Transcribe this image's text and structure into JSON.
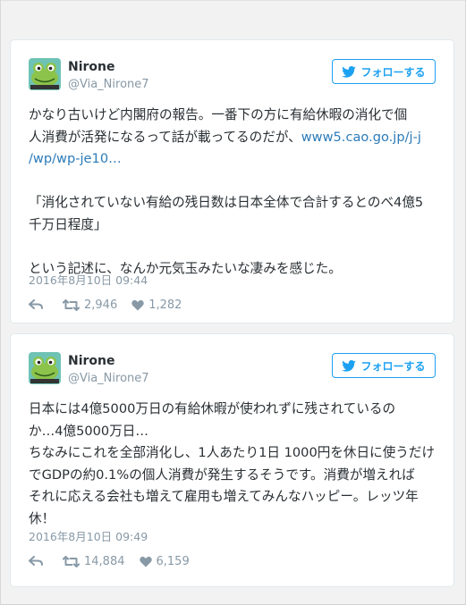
{
  "tweets": [
    {
      "author": {
        "name": "Nirone",
        "handle": "@Via_Nirone7"
      },
      "follow_label": "フォローする",
      "text": {
        "line1": "かなり古いけど内閣府の報告。一番下の方に有給休暇の消化で個",
        "line2a": "人消費が活発になるって話が載ってるのだが、",
        "line2_link": "www5.cao.go.jp/j-j",
        "line3_link": "/wp/wp-je10…",
        "quote1": "「消化されていない有給の残日数は日本全体で合計するとのべ4億5",
        "quote2": "千万日程度」",
        "closing": "という記述に、なんか元気玉みたいな凄みを感じた。"
      },
      "timestamp": "2016年8月10日 09:44",
      "retweets": "2,946",
      "likes": "1,282"
    },
    {
      "author": {
        "name": "Nirone",
        "handle": "@Via_Nirone7"
      },
      "follow_label": "フォローする",
      "text": {
        "line1": "日本には4億5000万日の有給休暇が使われずに残されているの",
        "line2": "か…4億5000万日…",
        "line3": "ちなみにこれを全部消化し、1人あたり1日 1000円を休日に使うだけ",
        "line4": "でGDPの約0.1%の個人消費が発生するそうです。消費が増えれば",
        "line5": "それに応える会社も増えて雇用も増えてみんなハッピー。レッツ年",
        "line6": "休！"
      },
      "timestamp": "2016年8月10日 09:49",
      "retweets": "14,884",
      "likes": "6,159"
    }
  ],
  "colors": {
    "accent": "#1da1f2",
    "link": "#2b7bb9",
    "muted": "#8899a6",
    "text": "#292f33",
    "avatar_bg": "#6fc3b5",
    "avatar_frog": "#8cc34a"
  },
  "icons": [
    "twitter-bird-icon",
    "reply-icon",
    "retweet-icon",
    "heart-icon"
  ]
}
